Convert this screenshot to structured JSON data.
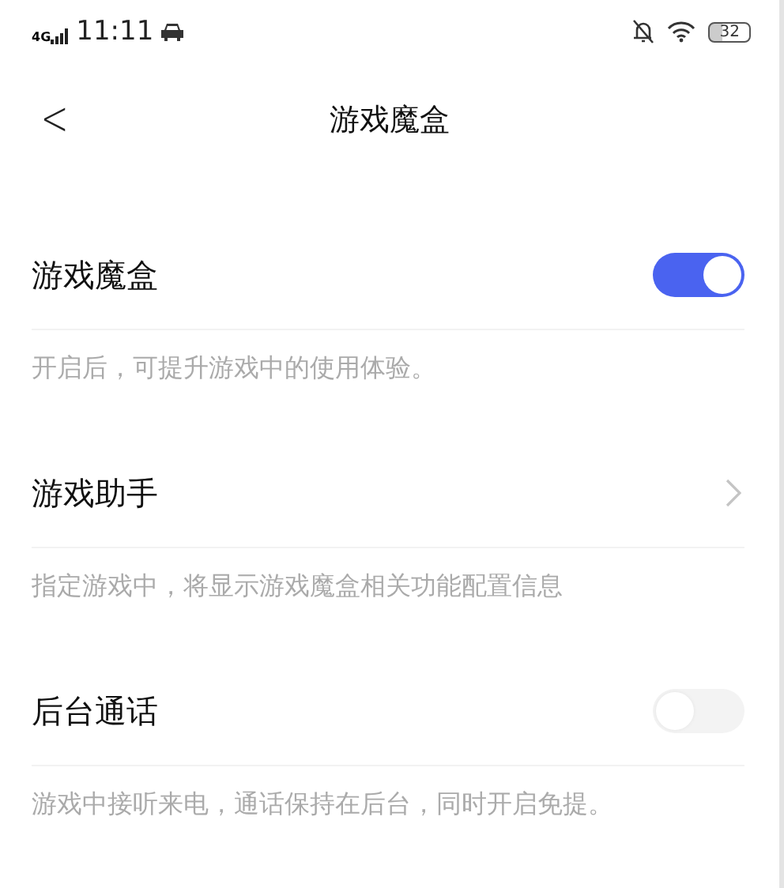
{
  "status_bar": {
    "network": "4G",
    "time": "11:11",
    "battery": "32"
  },
  "header": {
    "back": "<",
    "title": "游戏魔盒"
  },
  "settings": [
    {
      "kind": "toggle",
      "title": "游戏魔盒",
      "on": true,
      "description": "开启后，可提升游戏中的使用体验。"
    },
    {
      "kind": "link",
      "title": "游戏助手",
      "description": "指定游戏中，将显示游戏魔盒相关功能配置信息"
    },
    {
      "kind": "toggle",
      "title": "后台通话",
      "on": false,
      "description": "游戏中接听来电，通话保持在后台，同时开启免提。"
    }
  ]
}
